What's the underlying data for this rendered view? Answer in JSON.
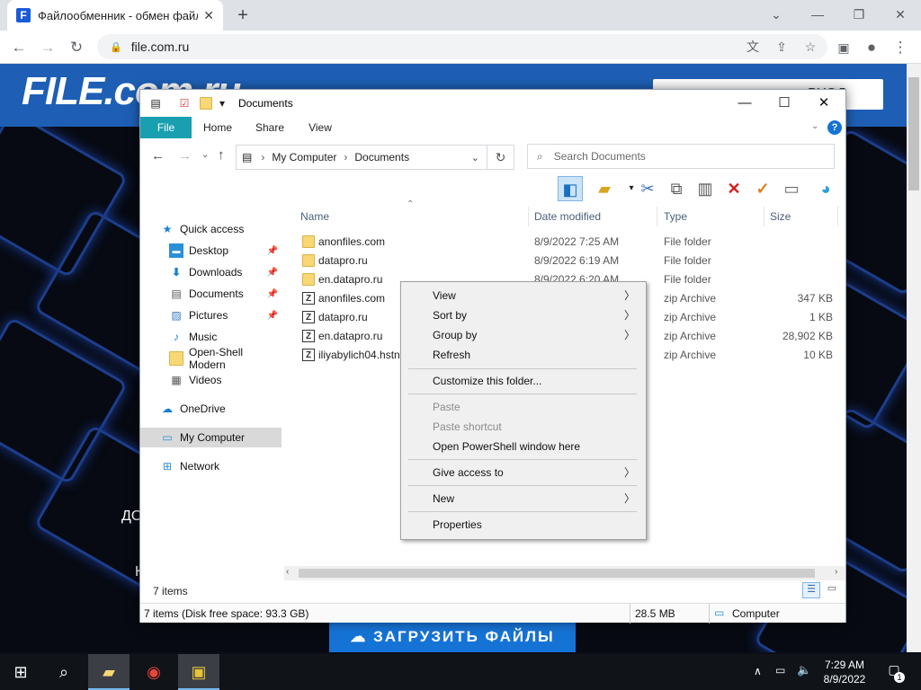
{
  "browser": {
    "tab_title": "Файлообменник - обмен файлами",
    "tab_close": "✕",
    "new_tab": "+",
    "url": "file.com.ru",
    "lock_icon": "🔒"
  },
  "site": {
    "logo": "FILE.com.ru",
    "login_label": "ВХОД",
    "promo_lines": [
      "ДО",
      "К"
    ],
    "upload_button": "ЗАГРУЗИТЬ ФАЙЛЫ"
  },
  "explorer": {
    "title": "Documents",
    "ribbon_tabs": [
      "File",
      "Home",
      "Share",
      "View"
    ],
    "help": "?",
    "breadcrumb": [
      "My Computer",
      "Documents"
    ],
    "search_placeholder": "Search Documents",
    "nav_items": [
      {
        "label": "Quick access",
        "icon": "star-icon",
        "pinned": false
      },
      {
        "label": "Desktop",
        "icon": "desktop-icon",
        "pinned": true
      },
      {
        "label": "Downloads",
        "icon": "download-icon",
        "pinned": true
      },
      {
        "label": "Documents",
        "icon": "document-icon",
        "pinned": true
      },
      {
        "label": "Pictures",
        "icon": "picture-icon",
        "pinned": true
      },
      {
        "label": "Music",
        "icon": "music-icon",
        "pinned": false
      },
      {
        "label": "Open-Shell Modern",
        "icon": "folder-icon",
        "pinned": false
      },
      {
        "label": "Videos",
        "icon": "video-icon",
        "pinned": false
      },
      {
        "label": "OneDrive",
        "icon": "cloud-icon",
        "pinned": false
      },
      {
        "label": "My Computer",
        "icon": "computer-icon",
        "pinned": false,
        "selected": true
      },
      {
        "label": "Network",
        "icon": "network-icon",
        "pinned": false
      }
    ],
    "columns": [
      "Name",
      "Date modified",
      "Type",
      "Size"
    ],
    "files": [
      {
        "name": "anonfiles.com",
        "date": "8/9/2022 7:25 AM",
        "type": "File folder",
        "size": "",
        "kind": "folder"
      },
      {
        "name": "datapro.ru",
        "date": "8/9/2022 6:19 AM",
        "type": "File folder",
        "size": "",
        "kind": "folder"
      },
      {
        "name": "en.datapro.ru",
        "date": "8/9/2022 6:20 AM",
        "type": "File folder",
        "size": "",
        "kind": "folder"
      },
      {
        "name": "anonfiles.com",
        "date": "",
        "type": "zip Archive",
        "size": "347 KB",
        "kind": "zip"
      },
      {
        "name": "datapro.ru",
        "date": "",
        "type": "zip Archive",
        "size": "1 KB",
        "kind": "zip"
      },
      {
        "name": "en.datapro.ru",
        "date": "",
        "type": "zip Archive",
        "size": "28,902 KB",
        "kind": "zip"
      },
      {
        "name": "iliyabylich04.hstn",
        "date": "",
        "type": "zip Archive",
        "size": "10 KB",
        "kind": "zip"
      }
    ],
    "item_count": "7 items",
    "disk_status": "7 items (Disk free space: 93.3 GB)",
    "size_status": "28.5 MB",
    "computer_status": "Computer"
  },
  "context_menu": {
    "items": [
      {
        "label": "View",
        "submenu": true,
        "disabled": false
      },
      {
        "label": "Sort by",
        "submenu": true,
        "disabled": false
      },
      {
        "label": "Group by",
        "submenu": true,
        "disabled": false
      },
      {
        "label": "Refresh",
        "submenu": false,
        "disabled": false
      },
      {
        "label": "Customize this folder...",
        "submenu": false,
        "disabled": false
      },
      {
        "label": "Paste",
        "submenu": false,
        "disabled": true
      },
      {
        "label": "Paste shortcut",
        "submenu": false,
        "disabled": true
      },
      {
        "label": "Open PowerShell window here",
        "submenu": false,
        "disabled": false
      },
      {
        "label": "Give access to",
        "submenu": true,
        "disabled": false
      },
      {
        "label": "New",
        "submenu": true,
        "disabled": false
      },
      {
        "label": "Properties",
        "submenu": false,
        "disabled": false
      }
    ]
  },
  "taskbar": {
    "time": "7:29 AM",
    "date": "8/9/2022",
    "notification_count": "1"
  },
  "colors": {
    "site_blue": "#1e5fb5",
    "ribbon_file": "#19a0b0",
    "upload_button": "#1673d6"
  }
}
